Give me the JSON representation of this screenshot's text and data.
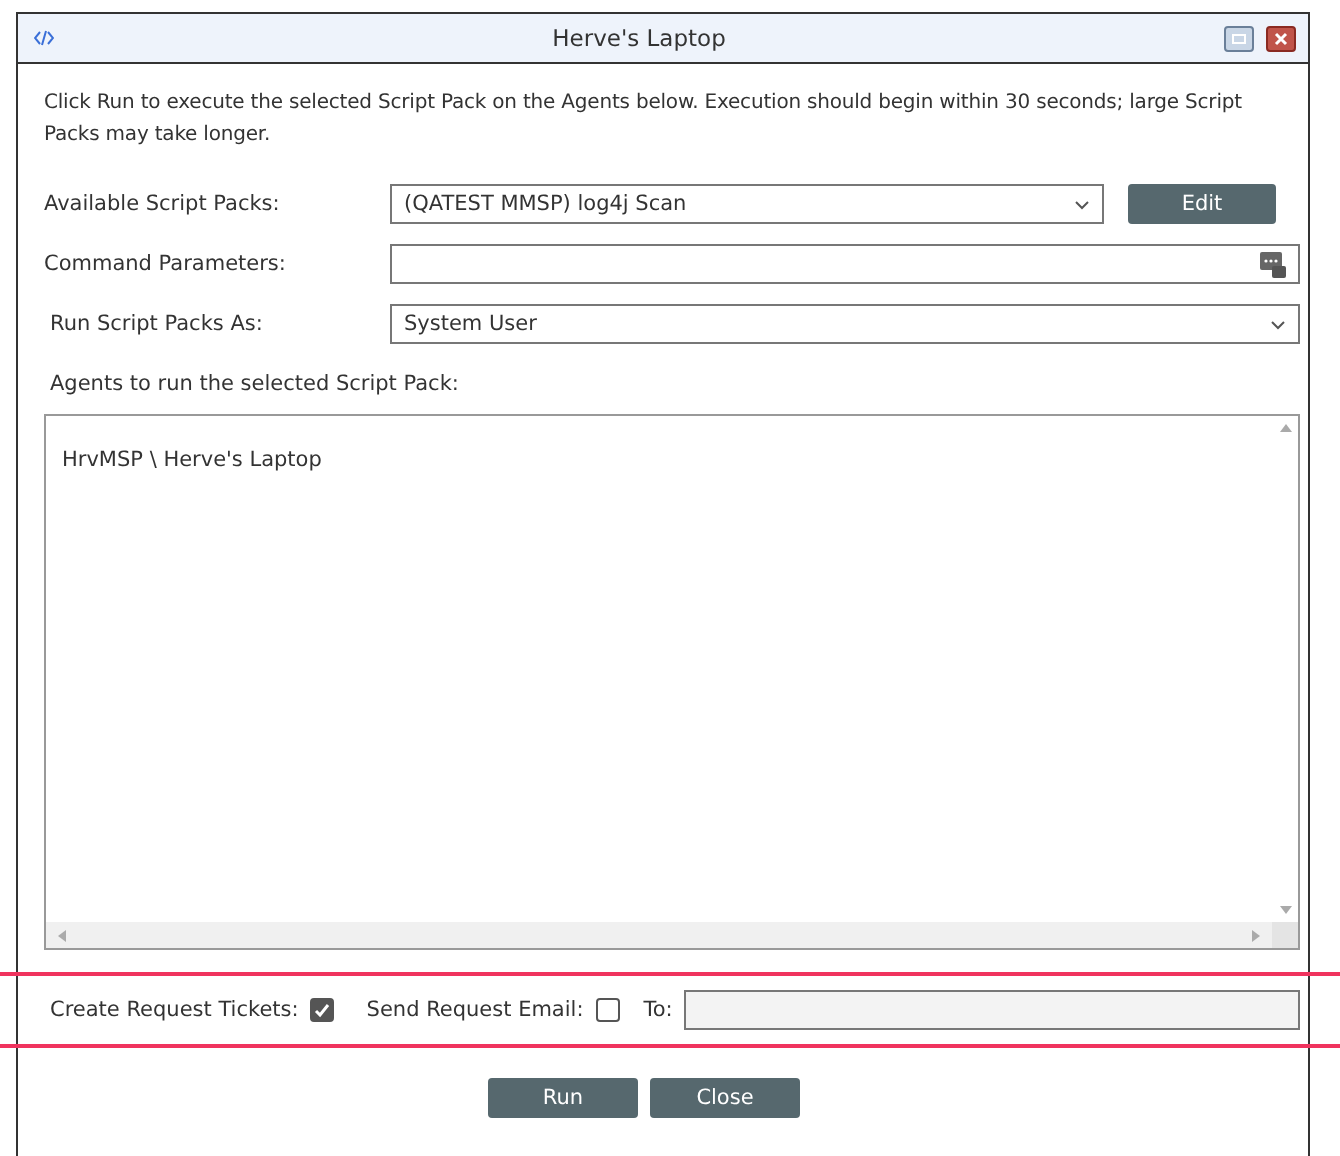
{
  "window": {
    "title": "Herve's Laptop"
  },
  "intro": "Click Run to execute the selected Script Pack on the Agents below. Execution should begin within 30 seconds; large Script Packs may take longer.",
  "fields": [
    {
      "kind": "select",
      "label": "Available Script Packs:",
      "value": "(QATEST MMSP) log4j Scan",
      "button": "Edit"
    },
    {
      "kind": "params",
      "label": "Command Parameters:"
    },
    {
      "kind": "select",
      "label": "Run Script Packs As:",
      "value": "System User"
    }
  ],
  "agents": {
    "label": "Agents to run the selected Script Pack:",
    "items": [
      "HrvMSP \\ Herve's Laptop"
    ]
  },
  "options": {
    "tickets": {
      "label": "Create Request Tickets:",
      "checked": true
    },
    "email": {
      "label": "Send Request Email:",
      "checked": false
    },
    "to": {
      "label": "To:"
    }
  },
  "buttons": [
    "Run",
    "Close"
  ]
}
